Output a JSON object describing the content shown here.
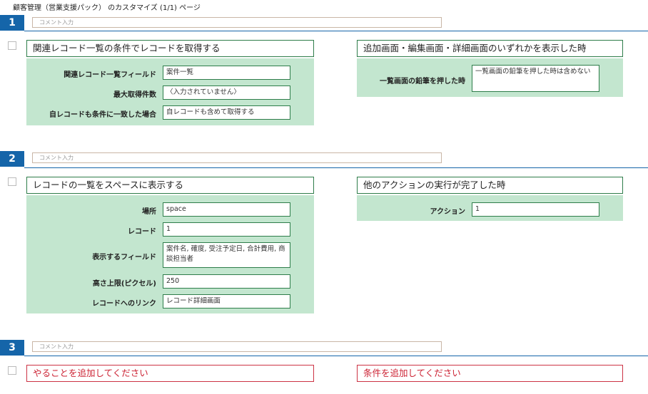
{
  "page": {
    "title": "顧客管理（営業支援パック） のカスタマイズ (1/1) ページ"
  },
  "comment_placeholder": "コメント入力",
  "steps": [
    {
      "number": "1",
      "action": {
        "title": "関連レコード一覧の条件でレコードを取得する",
        "fields": [
          {
            "label": "関連レコード一覧フィールド",
            "value": "案件一覧"
          },
          {
            "label": "最大取得件数",
            "value": "〈入力されていません〉"
          },
          {
            "label": "自レコードも条件に一致した場合",
            "value": "自レコードも含めて取得する"
          }
        ]
      },
      "condition": {
        "title": "追加画面・編集画面・詳細画面のいずれかを表示した時",
        "fields": [
          {
            "label": "一覧画面の鉛筆を押した時",
            "value": "一覧画面の鉛筆を押した時は含めない"
          }
        ]
      }
    },
    {
      "number": "2",
      "action": {
        "title": "レコードの一覧をスペースに表示する",
        "fields": [
          {
            "label": "場所",
            "value": "space"
          },
          {
            "label": "レコード",
            "value": "1"
          },
          {
            "label": "表示するフィールド",
            "value": "案件名, 確度, 受注予定日, 合計費用, 商談担当者"
          },
          {
            "label": "高さ上限(ピクセル)",
            "value": "250"
          },
          {
            "label": "レコードへのリンク",
            "value": "レコード詳細画面"
          }
        ]
      },
      "condition": {
        "title": "他のアクションの実行が完了した時",
        "fields": [
          {
            "label": "アクション",
            "value": "1"
          }
        ]
      }
    },
    {
      "number": "3",
      "action": {
        "title": "やることを追加してください"
      },
      "condition": {
        "title": "条件を追加してください"
      }
    }
  ]
}
